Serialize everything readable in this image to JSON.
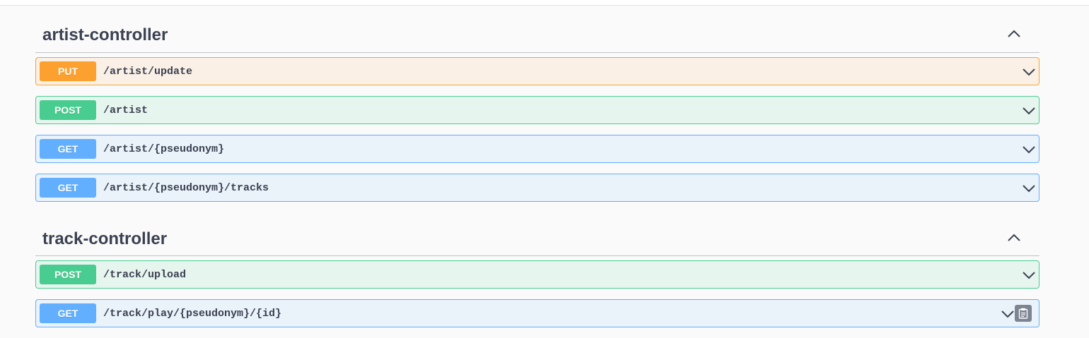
{
  "tags": [
    {
      "name": "artist-controller",
      "operations": [
        {
          "method": "PUT",
          "path": "/artist/update"
        },
        {
          "method": "POST",
          "path": "/artist"
        },
        {
          "method": "GET",
          "path": "/artist/{pseudonym}"
        },
        {
          "method": "GET",
          "path": "/artist/{pseudonym}/tracks"
        }
      ]
    },
    {
      "name": "track-controller",
      "operations": [
        {
          "method": "POST",
          "path": "/track/upload"
        },
        {
          "method": "GET",
          "path": "/track/play/{pseudonym}/{id}"
        }
      ]
    }
  ],
  "colors": {
    "put": "#fca130",
    "post": "#49cc90",
    "get": "#61affe",
    "text": "#3b4151",
    "copy_button": "#7d8492"
  },
  "icons": {
    "tag_toggle": "chevron-up-icon",
    "operation_toggle": "chevron-down-icon",
    "copy": "clipboard-icon"
  }
}
